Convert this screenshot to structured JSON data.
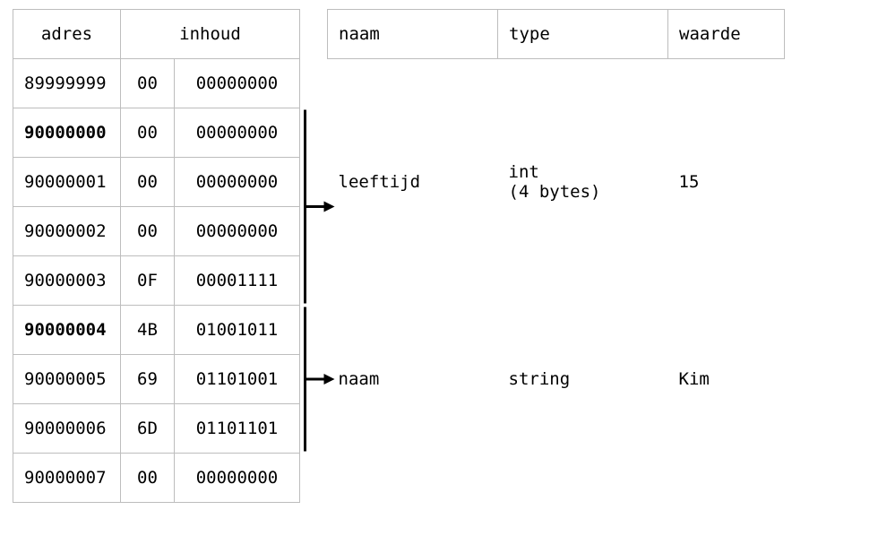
{
  "memory": {
    "headers": {
      "adres": "adres",
      "inhoud": "inhoud"
    },
    "rows": [
      {
        "addr": "89999999",
        "hex": "00",
        "bin": "00000000",
        "bold": false
      },
      {
        "addr": "90000000",
        "hex": "00",
        "bin": "00000000",
        "bold": true
      },
      {
        "addr": "90000001",
        "hex": "00",
        "bin": "00000000",
        "bold": false
      },
      {
        "addr": "90000002",
        "hex": "00",
        "bin": "00000000",
        "bold": false
      },
      {
        "addr": "90000003",
        "hex": "0F",
        "bin": "00001111",
        "bold": false
      },
      {
        "addr": "90000004",
        "hex": "4B",
        "bin": "01001011",
        "bold": true
      },
      {
        "addr": "90000005",
        "hex": "69",
        "bin": "01101001",
        "bold": false
      },
      {
        "addr": "90000006",
        "hex": "6D",
        "bin": "01101101",
        "bold": false
      },
      {
        "addr": "90000007",
        "hex": "00",
        "bin": "00000000",
        "bold": false
      }
    ]
  },
  "vars": {
    "headers": {
      "naam": "naam",
      "type": "type",
      "waarde": "waarde"
    },
    "rows": [
      {
        "naam": "leeftijd",
        "type": "int\n(4 bytes)",
        "waarde": "15"
      },
      {
        "naam": "naam",
        "type": "string",
        "waarde": "Kim"
      }
    ]
  },
  "brackets": [
    {
      "from_row": 1,
      "to_row": 4,
      "var_row": 0
    },
    {
      "from_row": 5,
      "to_row": 7,
      "var_row": 1
    }
  ]
}
